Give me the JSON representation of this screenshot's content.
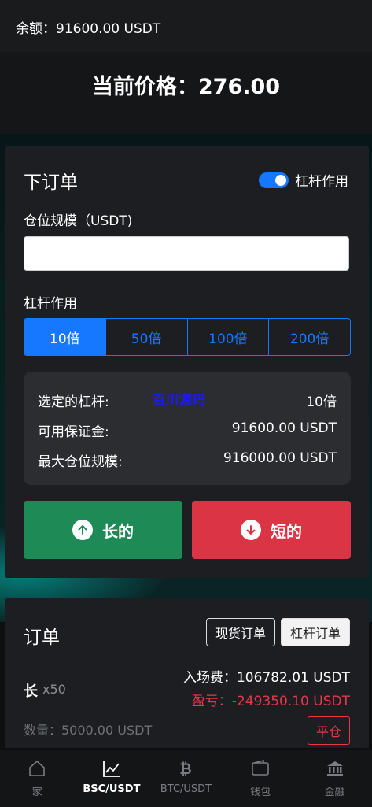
{
  "header": {
    "balance": "余额：91600.00 USDT"
  },
  "price": {
    "current": "当前价格：276.00"
  },
  "order_form": {
    "title": "下订单",
    "leverage_toggle_label": "杠杆作用",
    "size_label": "仓位规模（USDT)",
    "size_value": "",
    "leverage_label": "杠杆作用",
    "leverage_options": [
      "10倍",
      "50倍",
      "100倍",
      "200倍"
    ],
    "leverage_selected": "10倍",
    "summary": {
      "selected_label": "选定的杠杆:",
      "selected_value": "10倍",
      "watermark": "百川源码",
      "margin_label": "可用保证金:",
      "margin_value": "91600.00 USDT",
      "max_label": "最大仓位规模:",
      "max_value": "916000.00 USDT"
    },
    "long_label": "长的",
    "short_label": "短的"
  },
  "orders": {
    "title": "订单",
    "tab_spot": "现货订单",
    "tab_leverage": "杠杆订单",
    "position": {
      "side": "长",
      "multiplier": "x50",
      "entry": "入场费：106782.01 USDT",
      "pnl": "盈亏：-249350.10 USDT",
      "quantity": "数量：5000.00 USDT",
      "close_label": "平仓"
    }
  },
  "nav": {
    "items": [
      {
        "label": "家",
        "icon": "home-icon"
      },
      {
        "label": "BSC/USDT",
        "icon": "chart-icon"
      },
      {
        "label": "BTC/USDT",
        "icon": "bitcoin-icon"
      },
      {
        "label": "钱包",
        "icon": "wallet-icon"
      },
      {
        "label": "金融",
        "icon": "bank-icon"
      }
    ],
    "active": "BSC/USDT"
  },
  "colors": {
    "accent": "#1677ff",
    "long": "#1e8a55",
    "short": "#db3445"
  }
}
